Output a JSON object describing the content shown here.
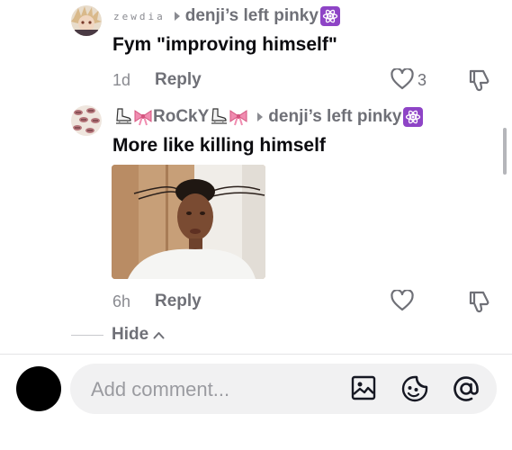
{
  "comments": [
    {
      "username": "zewdia",
      "reply_to": "denji’s left pinky",
      "text": "Fym \"improving himself\"",
      "time": "1d",
      "reply_label": "Reply",
      "like_count": "3"
    },
    {
      "username": "RoCkY",
      "reply_to": "denji’s left pinky",
      "text": "More like killing himself",
      "time": "6h",
      "reply_label": "Reply",
      "like_count": ""
    }
  ],
  "thread": {
    "hide_label": "Hide"
  },
  "composer": {
    "placeholder": "Add comment..."
  },
  "icons": {
    "badge": "atom-icon",
    "like": "heart-outline-icon",
    "dislike": "thumbs-down-icon",
    "image": "image-icon",
    "sticker": "sticker-icon",
    "mention": "at-mention-icon"
  },
  "colors": {
    "badge": "#8e44c6",
    "text_secondary": "#6f7077",
    "input_bg": "#f1f1f2"
  }
}
